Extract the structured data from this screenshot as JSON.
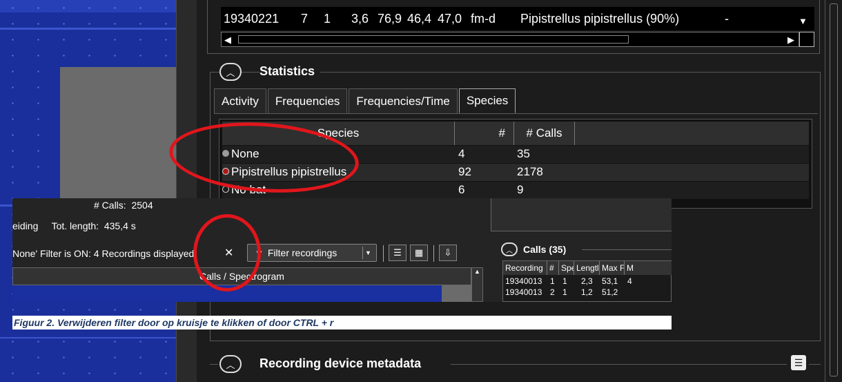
{
  "top_row": {
    "cells": [
      "19340221",
      "7",
      "1",
      "3,6",
      "76,9",
      "46,4",
      "47,0",
      "fm-d",
      "Pipistrellus pipistrellus (90%)",
      "-"
    ]
  },
  "statistics": {
    "title": "Statistics",
    "tabs": [
      "Activity",
      "Frequencies",
      "Frequencies/Time",
      "Species"
    ],
    "active_tab": "Species",
    "columns": [
      "Species",
      "#",
      "# Calls"
    ],
    "rows": [
      {
        "species": "None",
        "count": "4",
        "calls": "35",
        "dot_color": "#9a9a9a"
      },
      {
        "species": "Pipistrellus pipistrellus",
        "count": "92",
        "calls": "2178",
        "dot_color": "#b01818"
      },
      {
        "species": "No bat",
        "count": "6",
        "calls": "9",
        "dot_color": "#1c1c1c"
      }
    ]
  },
  "insert": {
    "calls_label": "# Calls:",
    "calls_value": "2504",
    "left_fragment": "eiding",
    "length_label": "Tot. length:",
    "length_value": "435,4 s",
    "filter_text": "None' Filter is ON: 4 Recordings displayed",
    "clear_symbol": "✕",
    "filter_button": "Filter recordings",
    "calls_header": "Calls / Spectrogram",
    "calls_box": {
      "title": "Calls (35)",
      "columns": [
        "Recording",
        "#",
        "Spe",
        "Lengtl",
        "Max F",
        "M"
      ],
      "row": [
        "19340013",
        "1",
        "1",
        "2,3",
        "53,1",
        "4"
      ],
      "row_partial": [
        "19340013",
        "2",
        "1",
        "1,2",
        "51,2"
      ]
    }
  },
  "caption": "Figuur 2. Verwijderen filter door op kruisje te klikken of door CTRL + r",
  "metadata_section": {
    "title": "Recording device metadata"
  },
  "colors": {
    "annotation_red": "#e0161c",
    "panel_dark": "#1c1c1c",
    "spectrogram_blue": "#1b2f9c",
    "caption_text": "#1f3864"
  },
  "icons": {
    "collapse": "chevron-up-icon",
    "filter": "funnel-icon",
    "list_view": "list-icon",
    "grid_view": "grid-icon",
    "export": "export-icon",
    "metadata": "document-icon"
  }
}
